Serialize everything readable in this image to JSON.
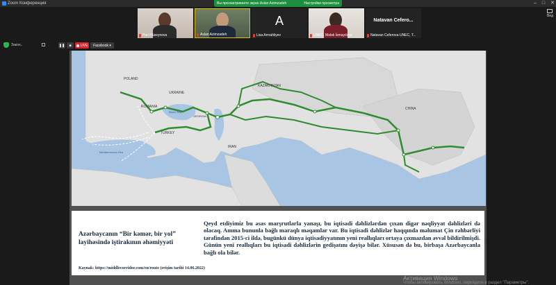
{
  "window": {
    "title": "Zoom Конференция"
  },
  "share_banner": {
    "text": "Вы просматриваете экран Aslan Azimzadeh",
    "settings": "Настройки просмотра"
  },
  "participants": [
    {
      "name": "Pəri Hüseynova"
    },
    {
      "name": "Aslan Azimzadeh"
    },
    {
      "name": "Lisa Amrahliyev",
      "initial": "A"
    },
    {
      "name": "UNEC, Mələk İsmayılova"
    },
    {
      "name": "Natavan Ceferova-UNEC, T...",
      "display": "Natavan Cefero..."
    }
  ],
  "view_button": {
    "label": "Вид"
  },
  "toolbar": {
    "screen_label": "Закон..",
    "live_label": "LIVE",
    "facebook_label": "Facebook"
  },
  "map": {
    "labels": {
      "poland": "POLAND",
      "ukraine": "UKRAINE",
      "romania": "ROMANIA",
      "kazakhstan": "KAZAKHSTAN",
      "turkey": "TURKEY",
      "georgia": "GEORGIA",
      "black_sea": "Black Sea",
      "med_sea": "Mediterranean Sea",
      "china": "CHINA",
      "iran": "IRAN"
    }
  },
  "slide": {
    "title": "Azərbaycanın “Bir kəmər, bir yol” layihəsində iştirakının əhəmiyyəti",
    "body": "Qeyd etdiyimiz bu əsas marşrutlarla yanaşı, bu iqtisadi dəhlizlərdən çıxan digər nəqliyyat dəhlizləri də olacaq. Amma bununla bağlı maraqlı məqamlar var. Bu iqtisadi dəhlizlər haqqında məlumat Çin rəhbərliyi tərəfindən 2015-ci ildə, bugünkü dünya iqtisadiyyatının yeni reallıqları ortaya çıxmazdan əvvəl bildirilmişdi. Günün yeni reallıqları bu iqtisadi dəhlizlərin gedişatını dəyişə bilər. Xüsusən də bu, birbaşa Azərbaycanla bağlı ola bilər.",
    "source": "Kaynak: https://middlecorridor.com/en/route (erişim tarihi 14.06.2022)"
  },
  "watermark": {
    "line1": "Активация Windows",
    "line2": "Чтобы активировать Windows, перейдите в раздел \"Параметры\"."
  }
}
